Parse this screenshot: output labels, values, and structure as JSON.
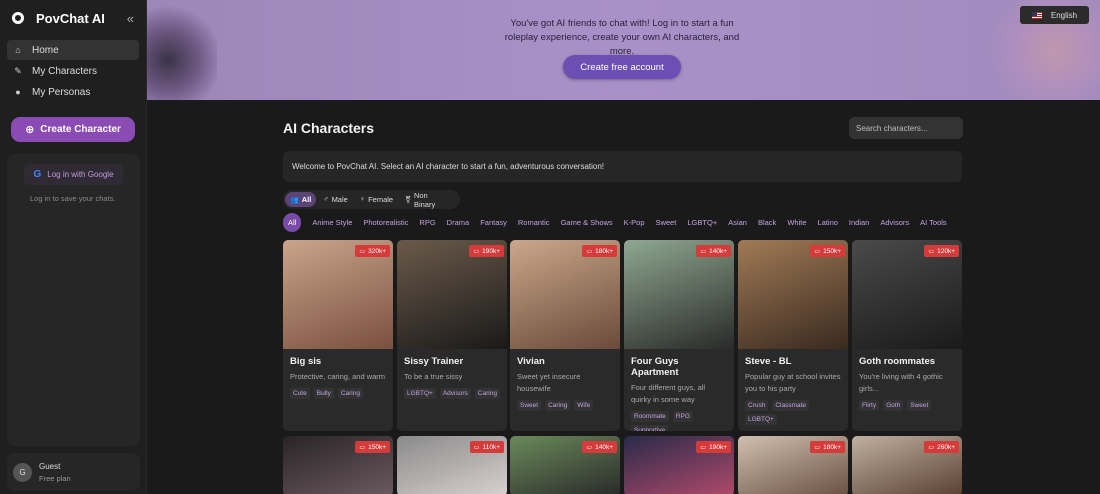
{
  "app": {
    "name": "PovChat AI"
  },
  "sidebar": {
    "nav": [
      {
        "label": "Home",
        "icon": "home-icon",
        "active": true
      },
      {
        "label": "My Characters",
        "icon": "pencil-icon",
        "active": false
      },
      {
        "label": "My Personas",
        "icon": "person-icon",
        "active": false
      }
    ],
    "create_label": "Create Character",
    "login_google": "Log in with Google",
    "login_hint": "Log in to save your chats.",
    "guest": {
      "initial": "G",
      "name": "Guest",
      "plan": "Free plan"
    }
  },
  "banner": {
    "message": "You've got AI friends to chat with! Log in to start a fun roleplay experience, create your own AI characters, and more.",
    "cta": "Create free account",
    "language": "English"
  },
  "main": {
    "title": "AI Characters",
    "search_placeholder": "Search characters...",
    "welcome": "Welcome to PovChat AI. Select an AI character to start a fun, adventurous conversation!",
    "genders": [
      {
        "label": "All",
        "icon": "group-icon",
        "active": true
      },
      {
        "label": "Male",
        "icon": "male-icon",
        "active": false
      },
      {
        "label": "Female",
        "icon": "female-icon",
        "active": false
      },
      {
        "label": "Non Binary",
        "icon": "nonbinary-icon",
        "active": false
      }
    ],
    "categories": [
      "All",
      "Anime Style",
      "Photorealistic",
      "RPG",
      "Drama",
      "Fantasy",
      "Romantic",
      "Game & Shows",
      "K-Pop",
      "Sweet",
      "LGBTQ+",
      "Asian",
      "Black",
      "White",
      "Latino",
      "Indian",
      "Advisors",
      "AI Tools"
    ],
    "cards": [
      {
        "name": "Big sis",
        "desc": "Protective, caring, and warm",
        "count": "320k+",
        "tags": [
          "Cute",
          "Bully",
          "Caring"
        ],
        "colors": [
          "#c9a48a",
          "#7a5040"
        ]
      },
      {
        "name": "Sissy Trainer",
        "desc": "To be a true sissy",
        "count": "190k+",
        "tags": [
          "LGBTQ+",
          "Advisors",
          "Caring"
        ],
        "colors": [
          "#6b5a4a",
          "#1a1a1a"
        ]
      },
      {
        "name": "Vivian",
        "desc": "Sweet yet insecure housewife",
        "count": "180k+",
        "tags": [
          "Sweet",
          "Caring",
          "Wife"
        ],
        "colors": [
          "#caa88a",
          "#6a4a3a"
        ]
      },
      {
        "name": "Four Guys Apartment",
        "desc": "Four different guys, all quirky in some way",
        "count": "140k+",
        "tags": [
          "Roommate",
          "RPG",
          "Supportive"
        ],
        "colors": [
          "#8fa890",
          "#2a2a2a"
        ]
      },
      {
        "name": "Steve - BL",
        "desc": "Popular guy at school invites you to his party",
        "count": "150k+",
        "tags": [
          "Crush",
          "Classmate",
          "LGBTQ+"
        ],
        "colors": [
          "#a07a55",
          "#3a2a20"
        ]
      },
      {
        "name": "Goth roommates",
        "desc": "You're living with 4 gothic girls...",
        "count": "120k+",
        "tags": [
          "Flirty",
          "Goth",
          "Sweet"
        ],
        "colors": [
          "#4a4a4a",
          "#1a1a1a"
        ]
      }
    ],
    "cards_row2": [
      {
        "count": "150k+",
        "colors": [
          "#2a2426",
          "#6a5a60"
        ]
      },
      {
        "count": "110k+",
        "colors": [
          "#8a8a8a",
          "#d9d0d0"
        ]
      },
      {
        "count": "140k+",
        "colors": [
          "#6a8a5a",
          "#2a2a2a"
        ]
      },
      {
        "count": "190k+",
        "colors": [
          "#2a2a4a",
          "#b04a6a"
        ]
      },
      {
        "count": "180k+",
        "colors": [
          "#d0c0b0",
          "#6a5040"
        ]
      },
      {
        "count": "260k+",
        "colors": [
          "#c0b0a0",
          "#5a4030"
        ]
      }
    ]
  }
}
